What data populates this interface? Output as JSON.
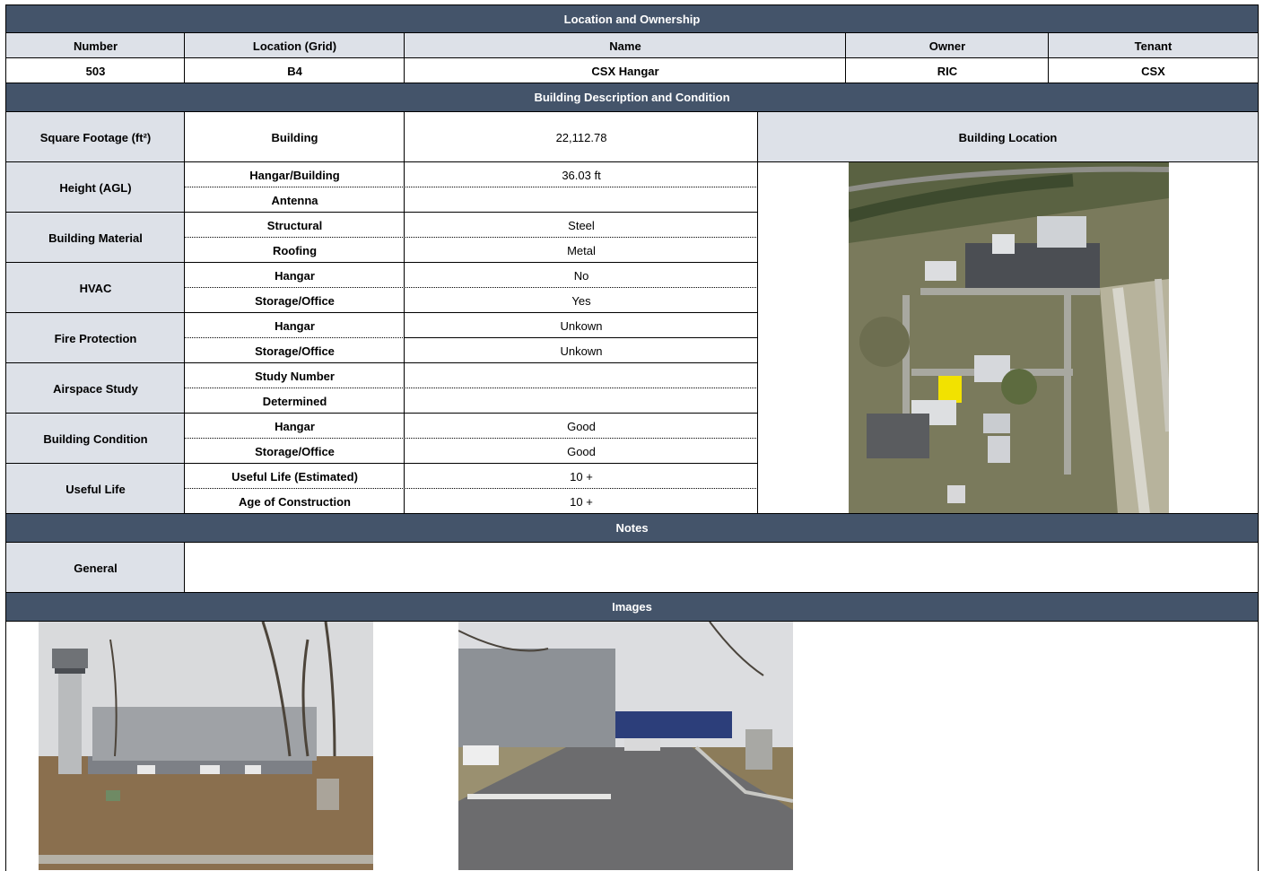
{
  "sections": {
    "ownership": "Location and Ownership",
    "description": "Building Description and Condition",
    "notes": "Notes",
    "images": "Images"
  },
  "ownership": {
    "headers": [
      "Number",
      "Location (Grid)",
      "Name",
      "Owner",
      "Tenant"
    ],
    "values": [
      "503",
      "B4",
      "CSX Hangar",
      "RIC",
      "CSX"
    ]
  },
  "description": {
    "sqft": {
      "label": "Square Footage (ft²)",
      "sub": "Building",
      "value": "22,112.78"
    },
    "building_location_label": "Building Location",
    "groups": [
      {
        "label": "Height (AGL)",
        "rows": [
          {
            "sub": "Hangar/Building",
            "value": "36.03 ft"
          },
          {
            "sub": "Antenna",
            "value": ""
          }
        ]
      },
      {
        "label": "Building Material",
        "rows": [
          {
            "sub": "Structural",
            "value": "Steel"
          },
          {
            "sub": "Roofing",
            "value": "Metal"
          }
        ]
      },
      {
        "label": "HVAC",
        "rows": [
          {
            "sub": "Hangar",
            "value": "No"
          },
          {
            "sub": "Storage/Office",
            "value": "Yes"
          }
        ]
      },
      {
        "label": "Fire Protection",
        "rows": [
          {
            "sub": "Hangar",
            "value": "Unkown"
          },
          {
            "sub": "Storage/Office",
            "value": "Unkown"
          }
        ]
      },
      {
        "label": "Airspace Study",
        "rows": [
          {
            "sub": "Study Number",
            "value": ""
          },
          {
            "sub": "Determined",
            "value": ""
          }
        ]
      },
      {
        "label": "Building Condition",
        "rows": [
          {
            "sub": "Hangar",
            "value": "Good"
          },
          {
            "sub": "Storage/Office",
            "value": "Good"
          }
        ]
      },
      {
        "label": "Useful Life",
        "rows": [
          {
            "sub": "Useful Life (Estimated)",
            "value": "10 +"
          },
          {
            "sub": "Age of Construction",
            "value": "10 +"
          }
        ]
      }
    ]
  },
  "notes": {
    "general_label": "General",
    "general_value": ""
  },
  "colors": {
    "band": "#44546a",
    "header_fill": "#dde1e8",
    "highlight": "#f2e200"
  }
}
